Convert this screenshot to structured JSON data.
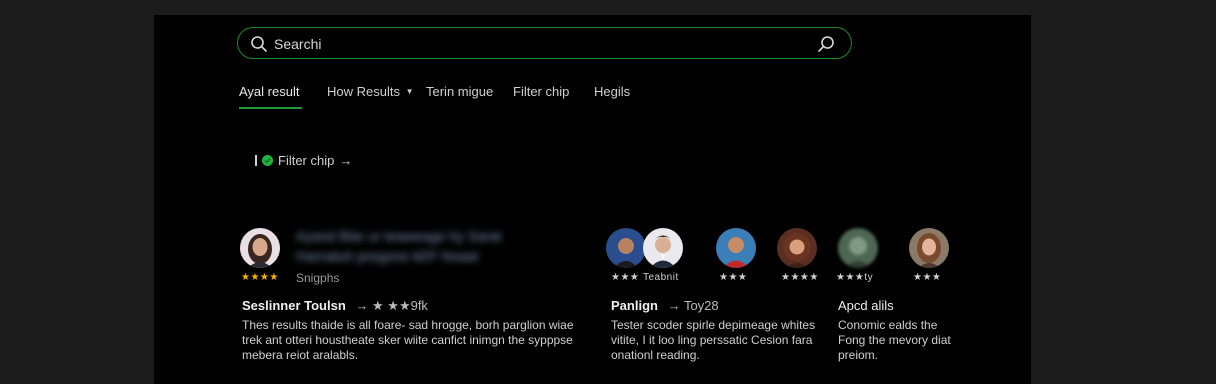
{
  "search": {
    "value": "Searchi"
  },
  "tabs": [
    {
      "label": "Ayal result",
      "active": true
    },
    {
      "label": "How Results"
    },
    {
      "label": "Terin migue"
    },
    {
      "label": "Filter chip"
    },
    {
      "label": "Hegils"
    }
  ],
  "filter_chip": {
    "label": "Filter chip"
  },
  "results": {
    "first": {
      "rating_stars": "★★★★",
      "blurred_line1": "Ayand Blar ur teaweage hy Sarat",
      "blurred_line2": "Harnatuh pregone kEF Nsaat",
      "snippet_label": "Snigphs",
      "title": "Seslinner Toulsn",
      "title_suffix": "→ ★ ★★9fk",
      "body": "Thes results thaide is all foare- sad hrogge, borh parglion wiae trek ant otteri houstheate sker wiite canfict inimgn the sypppse mebera reiot aralabls."
    },
    "avatars": [
      {
        "rating": "★★★",
        "tone": "#2a4d8f"
      },
      {
        "rating": "Teabnit",
        "tone": "#e9e9ee"
      },
      {
        "rating": "★★★",
        "tone": "#3c7fb8"
      },
      {
        "rating": "★★★★",
        "tone": "#5a2f22"
      },
      {
        "rating": "★★★ty",
        "tone": "#4e6654"
      },
      {
        "rating": "★★★",
        "tone": "#8d7a66"
      }
    ],
    "second": {
      "title": "Panlign",
      "title_suffix": "→ Toy28",
      "body": "Tester scoder spirle depimeage whites vitite, I it loo ling perssatic Cesion fara onationl reading."
    },
    "third": {
      "title": "Apcd alils",
      "body": "Conomic ealds the Fong the mevory diat preiom."
    }
  }
}
